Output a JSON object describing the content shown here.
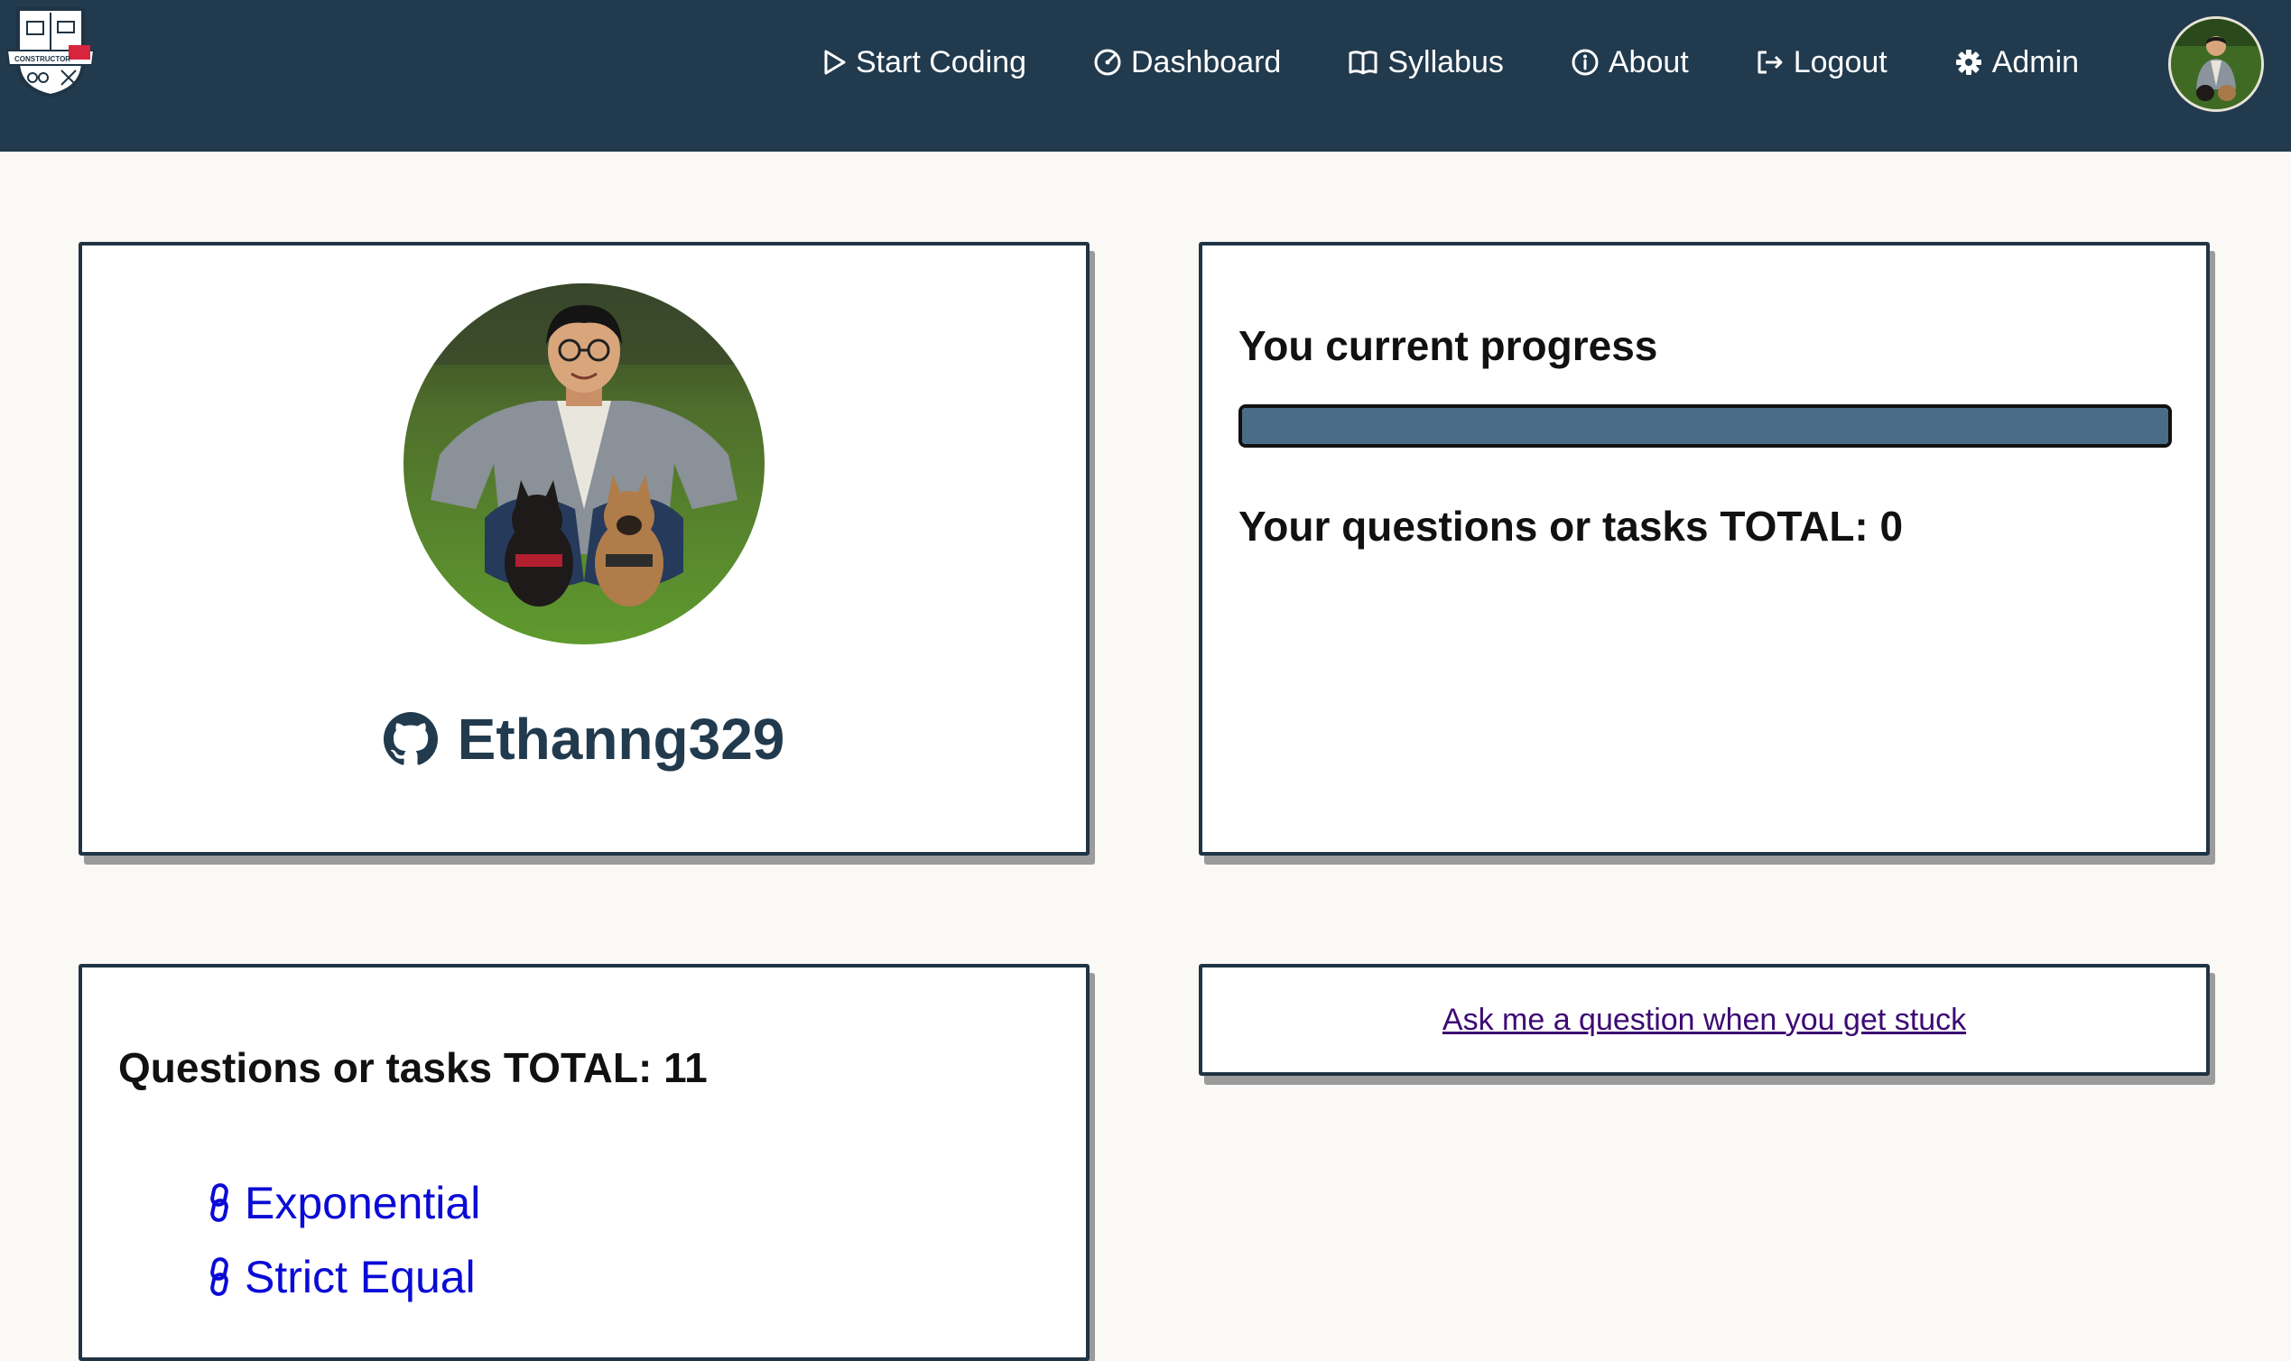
{
  "brand": {
    "logo_name": "constructor-logo",
    "logo_text": "CONSTRUCTOR"
  },
  "nav": {
    "items": [
      {
        "label": "Start Coding",
        "icon": "play-icon"
      },
      {
        "label": "Dashboard",
        "icon": "gauge-icon"
      },
      {
        "label": "Syllabus",
        "icon": "book-icon"
      },
      {
        "label": "About",
        "icon": "info-icon"
      },
      {
        "label": "Logout",
        "icon": "logout-icon"
      },
      {
        "label": "Admin",
        "icon": "gear-icon"
      }
    ]
  },
  "profile": {
    "username": "Ethanng329",
    "username_icon": "github-icon"
  },
  "progress": {
    "title": "You current progress",
    "fill_fraction": 1.0,
    "total_label": "Your questions or tasks TOTAL: 0"
  },
  "questions": {
    "title": "Questions or tasks TOTAL: 11",
    "items": [
      {
        "label": "Exponential",
        "icon": "link-icon"
      },
      {
        "label": "Strict Equal",
        "icon": "link-icon"
      }
    ]
  },
  "ask": {
    "link_text": "Ask me a question when you get stuck"
  },
  "colors": {
    "navbar": "#213a4d",
    "progress_fill": "#4a6d87",
    "link": "#0a0ad6",
    "visited_link": "#3d0a73",
    "page_bg": "#faf9f5"
  }
}
